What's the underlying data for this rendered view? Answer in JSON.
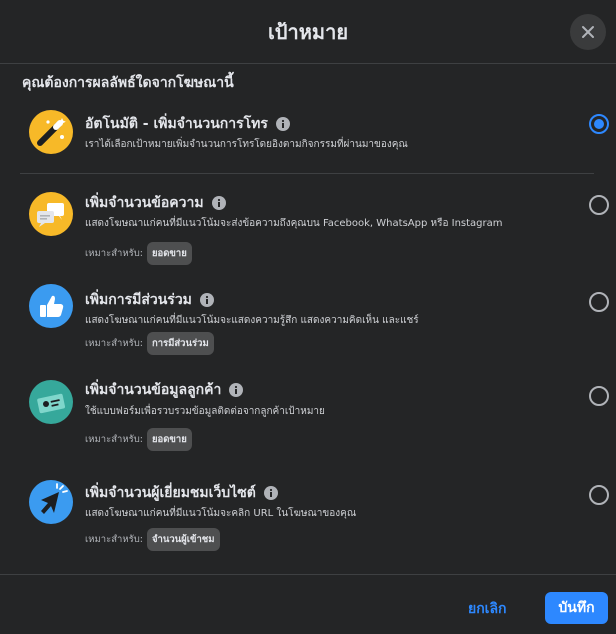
{
  "header": {
    "title": "เป้าหมาย"
  },
  "question": "คุณต้องการผลลัพธ์ใดจากโฆษณานี้",
  "for_label": "เหมาะสำหรับ:",
  "options": [
    {
      "title": "อัตโนมัติ - เพิ่มจำนวนการโทร",
      "description": "เราได้เลือกเป้าหมายเพิ่มจำนวนการโทรโดยอิงตามกิจกรรมที่ผ่านมาของคุณ",
      "selected": true
    },
    {
      "title": "เพิ่มจำนวนข้อความ",
      "description": "แสดงโฆษณาแก่คนที่มีแนวโน้มจะส่งข้อความถึงคุณบน Facebook, WhatsApp หรือ Instagram",
      "best_for": "ยอดขาย",
      "selected": false
    },
    {
      "title": "เพิ่มการมีส่วนร่วม",
      "description": "แสดงโฆษณาแก่คนที่มีแนวโน้มจะแสดงความรู้สึก แสดงความคิดเห็น และแชร์",
      "best_for": "การมีส่วนร่วม",
      "selected": false
    },
    {
      "title": "เพิ่มจำนวนข้อมูลลูกค้า",
      "description": "ใช้แบบฟอร์มเพื่อรวบรวมข้อมูลติดต่อจากลูกค้าเป้าหมาย",
      "best_for": "ยอดขาย",
      "selected": false
    },
    {
      "title": "เพิ่มจำนวนผู้เยี่ยมชมเว็บไซต์",
      "description": "แสดงโฆษณาแก่คนที่มีแนวโน้มจะคลิก URL ในโฆษณาของคุณ",
      "best_for": "จำนวนผู้เข้าชม",
      "selected": false
    }
  ],
  "footer": {
    "cancel_label": "ยกเลิก",
    "save_label": "บันทึก"
  },
  "colors": {
    "accent": "#2d88ff",
    "background": "#242526",
    "icon_bg": "#f7b928"
  }
}
